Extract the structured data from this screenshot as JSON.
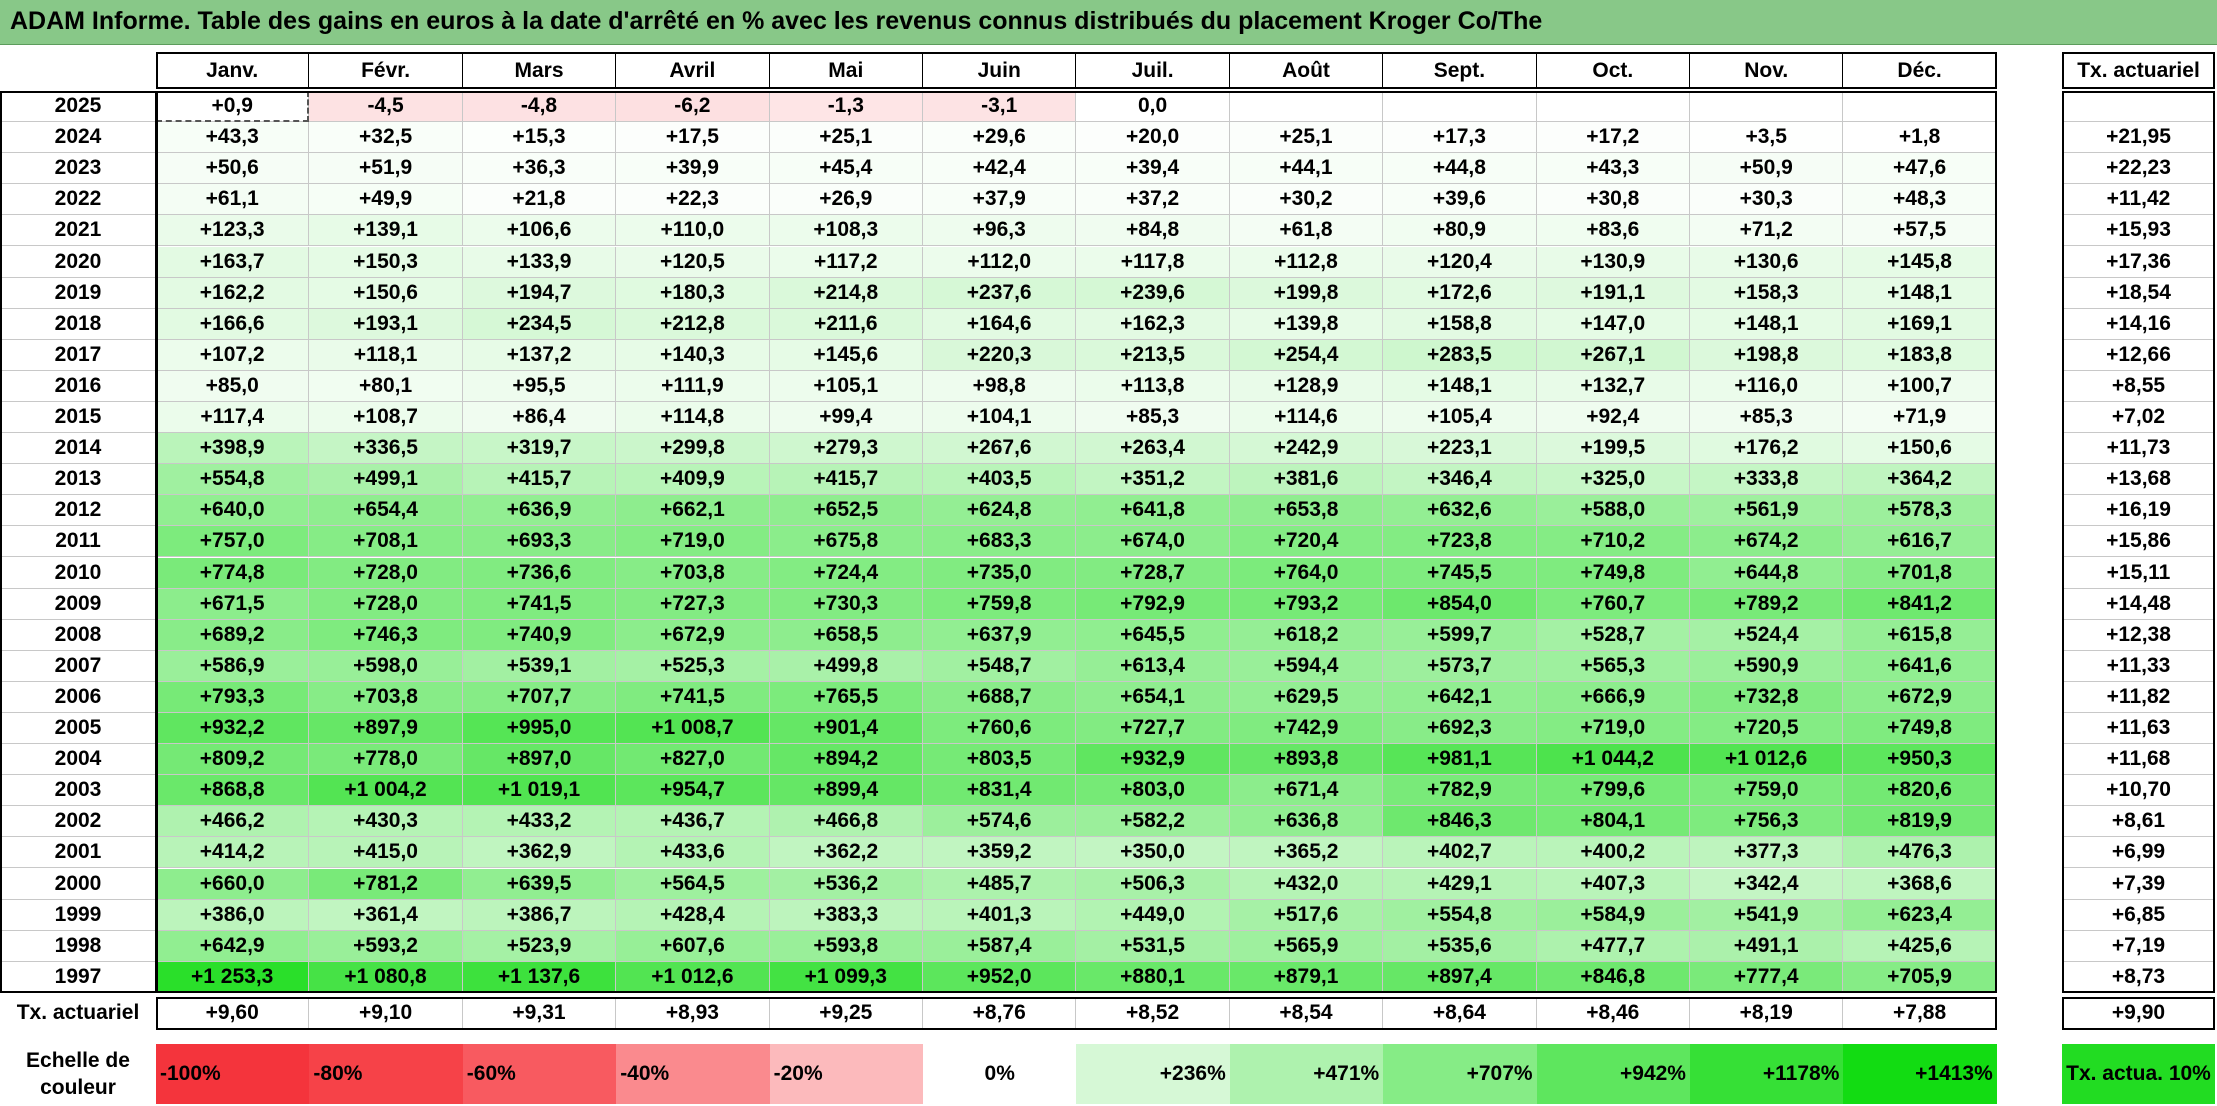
{
  "title": "ADAM Informe. Table des gains en euros à la date d'arrêté en % avec les revenus connus distribués du placement Kroger Co/The",
  "chart_data": {
    "type": "heatmap",
    "months": [
      "Janv.",
      "Févr.",
      "Mars",
      "Avril",
      "Mai",
      "Juin",
      "Juil.",
      "Août",
      "Sept.",
      "Oct.",
      "Nov.",
      "Déc."
    ],
    "rate_header": "Tx. actuariel",
    "rows": [
      {
        "year": "2025",
        "values": [
          "+0,9",
          "-4,5",
          "-4,8",
          "-6,2",
          "-1,3",
          "-3,1",
          "0,0",
          "",
          "",
          "",
          "",
          ""
        ],
        "rate": ""
      },
      {
        "year": "2024",
        "values": [
          "+43,3",
          "+32,5",
          "+15,3",
          "+17,5",
          "+25,1",
          "+29,6",
          "+20,0",
          "+25,1",
          "+17,3",
          "+17,2",
          "+3,5",
          "+1,8"
        ],
        "rate": "+21,95"
      },
      {
        "year": "2023",
        "values": [
          "+50,6",
          "+51,9",
          "+36,3",
          "+39,9",
          "+45,4",
          "+42,4",
          "+39,4",
          "+44,1",
          "+44,8",
          "+43,3",
          "+50,9",
          "+47,6"
        ],
        "rate": "+22,23"
      },
      {
        "year": "2022",
        "values": [
          "+61,1",
          "+49,9",
          "+21,8",
          "+22,3",
          "+26,9",
          "+37,9",
          "+37,2",
          "+30,2",
          "+39,6",
          "+30,8",
          "+30,3",
          "+48,3"
        ],
        "rate": "+11,42"
      },
      {
        "year": "2021",
        "values": [
          "+123,3",
          "+139,1",
          "+106,6",
          "+110,0",
          "+108,3",
          "+96,3",
          "+84,8",
          "+61,8",
          "+80,9",
          "+83,6",
          "+71,2",
          "+57,5"
        ],
        "rate": "+15,93"
      },
      {
        "year": "2020",
        "values": [
          "+163,7",
          "+150,3",
          "+133,9",
          "+120,5",
          "+117,2",
          "+112,0",
          "+117,8",
          "+112,8",
          "+120,4",
          "+130,9",
          "+130,6",
          "+145,8"
        ],
        "rate": "+17,36"
      },
      {
        "year": "2019",
        "values": [
          "+162,2",
          "+150,6",
          "+194,7",
          "+180,3",
          "+214,8",
          "+237,6",
          "+239,6",
          "+199,8",
          "+172,6",
          "+191,1",
          "+158,3",
          "+148,1"
        ],
        "rate": "+18,54"
      },
      {
        "year": "2018",
        "values": [
          "+166,6",
          "+193,1",
          "+234,5",
          "+212,8",
          "+211,6",
          "+164,6",
          "+162,3",
          "+139,8",
          "+158,8",
          "+147,0",
          "+148,1",
          "+169,1"
        ],
        "rate": "+14,16"
      },
      {
        "year": "2017",
        "values": [
          "+107,2",
          "+118,1",
          "+137,2",
          "+140,3",
          "+145,6",
          "+220,3",
          "+213,5",
          "+254,4",
          "+283,5",
          "+267,1",
          "+198,8",
          "+183,8"
        ],
        "rate": "+12,66"
      },
      {
        "year": "2016",
        "values": [
          "+85,0",
          "+80,1",
          "+95,5",
          "+111,9",
          "+105,1",
          "+98,8",
          "+113,8",
          "+128,9",
          "+148,1",
          "+132,7",
          "+116,0",
          "+100,7"
        ],
        "rate": "+8,55"
      },
      {
        "year": "2015",
        "values": [
          "+117,4",
          "+108,7",
          "+86,4",
          "+114,8",
          "+99,4",
          "+104,1",
          "+85,3",
          "+114,6",
          "+105,4",
          "+92,4",
          "+85,3",
          "+71,9"
        ],
        "rate": "+7,02"
      },
      {
        "year": "2014",
        "values": [
          "+398,9",
          "+336,5",
          "+319,7",
          "+299,8",
          "+279,3",
          "+267,6",
          "+263,4",
          "+242,9",
          "+223,1",
          "+199,5",
          "+176,2",
          "+150,6"
        ],
        "rate": "+11,73"
      },
      {
        "year": "2013",
        "values": [
          "+554,8",
          "+499,1",
          "+415,7",
          "+409,9",
          "+415,7",
          "+403,5",
          "+351,2",
          "+381,6",
          "+346,4",
          "+325,0",
          "+333,8",
          "+364,2"
        ],
        "rate": "+13,68"
      },
      {
        "year": "2012",
        "values": [
          "+640,0",
          "+654,4",
          "+636,9",
          "+662,1",
          "+652,5",
          "+624,8",
          "+641,8",
          "+653,8",
          "+632,6",
          "+588,0",
          "+561,9",
          "+578,3"
        ],
        "rate": "+16,19"
      },
      {
        "year": "2011",
        "values": [
          "+757,0",
          "+708,1",
          "+693,3",
          "+719,0",
          "+675,8",
          "+683,3",
          "+674,0",
          "+720,4",
          "+723,8",
          "+710,2",
          "+674,2",
          "+616,7"
        ],
        "rate": "+15,86"
      },
      {
        "year": "2010",
        "values": [
          "+774,8",
          "+728,0",
          "+736,6",
          "+703,8",
          "+724,4",
          "+735,0",
          "+728,7",
          "+764,0",
          "+745,5",
          "+749,8",
          "+644,8",
          "+701,8"
        ],
        "rate": "+15,11"
      },
      {
        "year": "2009",
        "values": [
          "+671,5",
          "+728,0",
          "+741,5",
          "+727,3",
          "+730,3",
          "+759,8",
          "+792,9",
          "+793,2",
          "+854,0",
          "+760,7",
          "+789,2",
          "+841,2"
        ],
        "rate": "+14,48"
      },
      {
        "year": "2008",
        "values": [
          "+689,2",
          "+746,3",
          "+740,9",
          "+672,9",
          "+658,5",
          "+637,9",
          "+645,5",
          "+618,2",
          "+599,7",
          "+528,7",
          "+524,4",
          "+615,8"
        ],
        "rate": "+12,38"
      },
      {
        "year": "2007",
        "values": [
          "+586,9",
          "+598,0",
          "+539,1",
          "+525,3",
          "+499,8",
          "+548,7",
          "+613,4",
          "+594,4",
          "+573,7",
          "+565,3",
          "+590,9",
          "+641,6"
        ],
        "rate": "+11,33"
      },
      {
        "year": "2006",
        "values": [
          "+793,3",
          "+703,8",
          "+707,7",
          "+741,5",
          "+765,5",
          "+688,7",
          "+654,1",
          "+629,5",
          "+642,1",
          "+666,9",
          "+732,8",
          "+672,9"
        ],
        "rate": "+11,82"
      },
      {
        "year": "2005",
        "values": [
          "+932,2",
          "+897,9",
          "+995,0",
          "+1 008,7",
          "+901,4",
          "+760,6",
          "+727,7",
          "+742,9",
          "+692,3",
          "+719,0",
          "+720,5",
          "+749,8"
        ],
        "rate": "+11,63"
      },
      {
        "year": "2004",
        "values": [
          "+809,2",
          "+778,0",
          "+897,0",
          "+827,0",
          "+894,2",
          "+803,5",
          "+932,9",
          "+893,8",
          "+981,1",
          "+1 044,2",
          "+1 012,6",
          "+950,3"
        ],
        "rate": "+11,68"
      },
      {
        "year": "2003",
        "values": [
          "+868,8",
          "+1 004,2",
          "+1 019,1",
          "+954,7",
          "+899,4",
          "+831,4",
          "+803,0",
          "+671,4",
          "+782,9",
          "+799,6",
          "+759,0",
          "+820,6"
        ],
        "rate": "+10,70"
      },
      {
        "year": "2002",
        "values": [
          "+466,2",
          "+430,3",
          "+433,2",
          "+436,7",
          "+466,8",
          "+574,6",
          "+582,2",
          "+636,8",
          "+846,3",
          "+804,1",
          "+756,3",
          "+819,9"
        ],
        "rate": "+8,61"
      },
      {
        "year": "2001",
        "values": [
          "+414,2",
          "+415,0",
          "+362,9",
          "+433,6",
          "+362,2",
          "+359,2",
          "+350,0",
          "+365,2",
          "+402,7",
          "+400,2",
          "+377,3",
          "+476,3"
        ],
        "rate": "+6,99"
      },
      {
        "year": "2000",
        "values": [
          "+660,0",
          "+781,2",
          "+639,5",
          "+564,5",
          "+536,2",
          "+485,7",
          "+506,3",
          "+432,0",
          "+429,1",
          "+407,3",
          "+342,4",
          "+368,6"
        ],
        "rate": "+7,39"
      },
      {
        "year": "1999",
        "values": [
          "+386,0",
          "+361,4",
          "+386,7",
          "+428,4",
          "+383,3",
          "+401,3",
          "+449,0",
          "+517,6",
          "+554,8",
          "+584,9",
          "+541,9",
          "+623,4"
        ],
        "rate": "+6,85"
      },
      {
        "year": "1998",
        "values": [
          "+642,9",
          "+593,2",
          "+523,9",
          "+607,6",
          "+593,8",
          "+587,4",
          "+531,5",
          "+565,9",
          "+535,6",
          "+477,7",
          "+491,1",
          "+425,6"
        ],
        "rate": "+7,19"
      },
      {
        "year": "1997",
        "values": [
          "+1 253,3",
          "+1 080,8",
          "+1 137,6",
          "+1 012,6",
          "+1 099,3",
          "+952,0",
          "+880,1",
          "+879,1",
          "+897,4",
          "+846,8",
          "+777,4",
          "+705,9"
        ],
        "rate": "+8,73"
      }
    ],
    "summary": {
      "label": "Tx. actuariel",
      "values": [
        "+9,60",
        "+9,10",
        "+9,31",
        "+8,93",
        "+9,25",
        "+8,76",
        "+8,52",
        "+8,54",
        "+8,64",
        "+8,46",
        "+8,19",
        "+7,88"
      ],
      "overall": "+9,90"
    },
    "color_scale": {
      "label": "Echelle de couleur",
      "stops": [
        {
          "label": "-100%",
          "value": -100,
          "color": "#f4343c"
        },
        {
          "label": "-80%",
          "value": -80,
          "color": "#f64248"
        },
        {
          "label": "-60%",
          "value": -60,
          "color": "#f85a60"
        },
        {
          "label": "-40%",
          "value": -40,
          "color": "#fa8a8e"
        },
        {
          "label": "-20%",
          "value": -20,
          "color": "#fcbabc"
        },
        {
          "label": "0%",
          "value": 0,
          "color": "#ffffff"
        },
        {
          "label": "+236%",
          "value": 236,
          "color": "#d6f8d6"
        },
        {
          "label": "+471%",
          "value": 471,
          "color": "#aef2ae"
        },
        {
          "label": "+707%",
          "value": 707,
          "color": "#86ec86"
        },
        {
          "label": "+942%",
          "value": 942,
          "color": "#5ee65e"
        },
        {
          "label": "+1178%",
          "value": 1178,
          "color": "#36e036"
        },
        {
          "label": "+1413%",
          "value": 1413,
          "color": "#12dc12"
        }
      ],
      "rate_legend": "Tx. actua. 10%",
      "rate_legend_color": "#22dc22"
    }
  }
}
